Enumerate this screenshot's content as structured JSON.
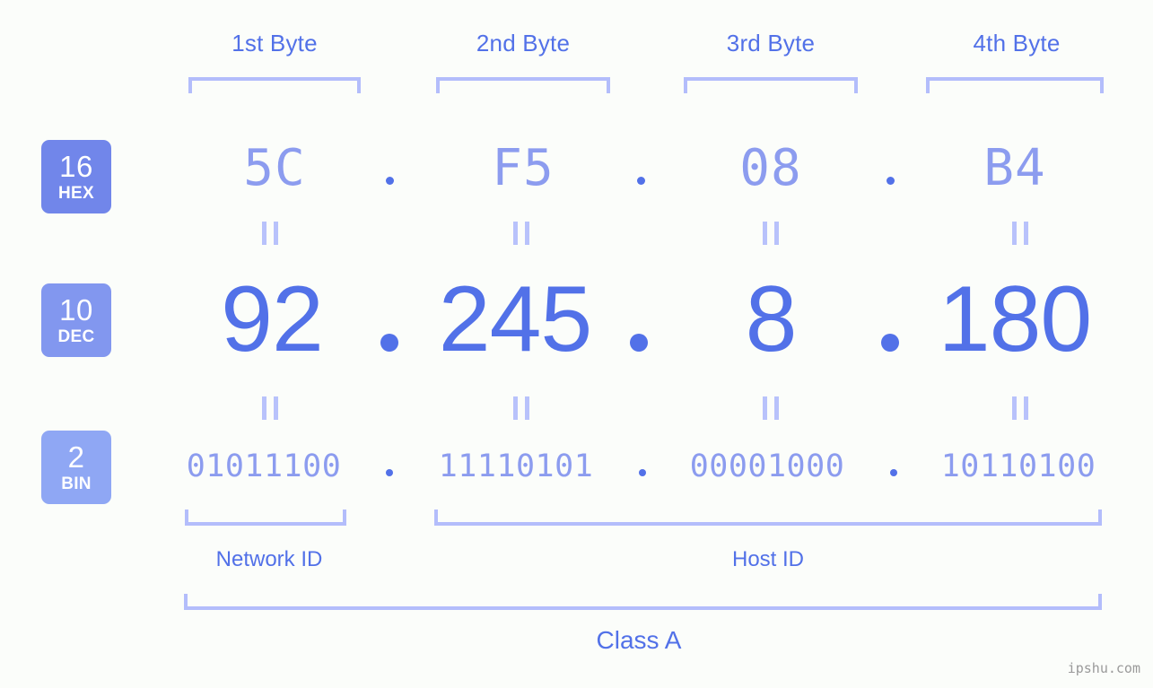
{
  "watermark": "ipshu.com",
  "byte_headers": [
    {
      "label": "1st Byte"
    },
    {
      "label": "2nd Byte"
    },
    {
      "label": "3rd Byte"
    },
    {
      "label": "4th Byte"
    }
  ],
  "bases": [
    {
      "id": "hex",
      "number": "16",
      "name": "HEX",
      "color": "#7186ea"
    },
    {
      "id": "dec",
      "number": "10",
      "name": "DEC",
      "color": "#8297ef"
    },
    {
      "id": "bin",
      "number": "2",
      "name": "BIN",
      "color": "#8fa7f4"
    }
  ],
  "rows": {
    "hex": {
      "octets": [
        "5C",
        "F5",
        "08",
        "B4"
      ],
      "separator": "."
    },
    "dec": {
      "octets": [
        "92",
        "245",
        "8",
        "180"
      ],
      "separator": "."
    },
    "bin": {
      "octets": [
        "01011100",
        "11110101",
        "00001000",
        "10110100"
      ],
      "separator": "."
    }
  },
  "equals_glyph": "=",
  "segments": [
    {
      "label": "Network ID"
    },
    {
      "label": "Host ID"
    }
  ],
  "class": {
    "label": "Class A"
  },
  "colors": {
    "background": "#fbfdfa",
    "accent_strong": "#5271e8",
    "accent_light": "#8c9cef",
    "bracket": "#b3bdfb",
    "equals": "#b8c2fb",
    "watermark": "#9a9a9a"
  },
  "ip_address": {
    "hex": "5C.F5.08.B4",
    "dec": "92.245.8.180",
    "bin": "01011100.11110101.00001000.10110100",
    "class": "Class A",
    "network_id_bits": 8,
    "host_id_bits": 24
  }
}
